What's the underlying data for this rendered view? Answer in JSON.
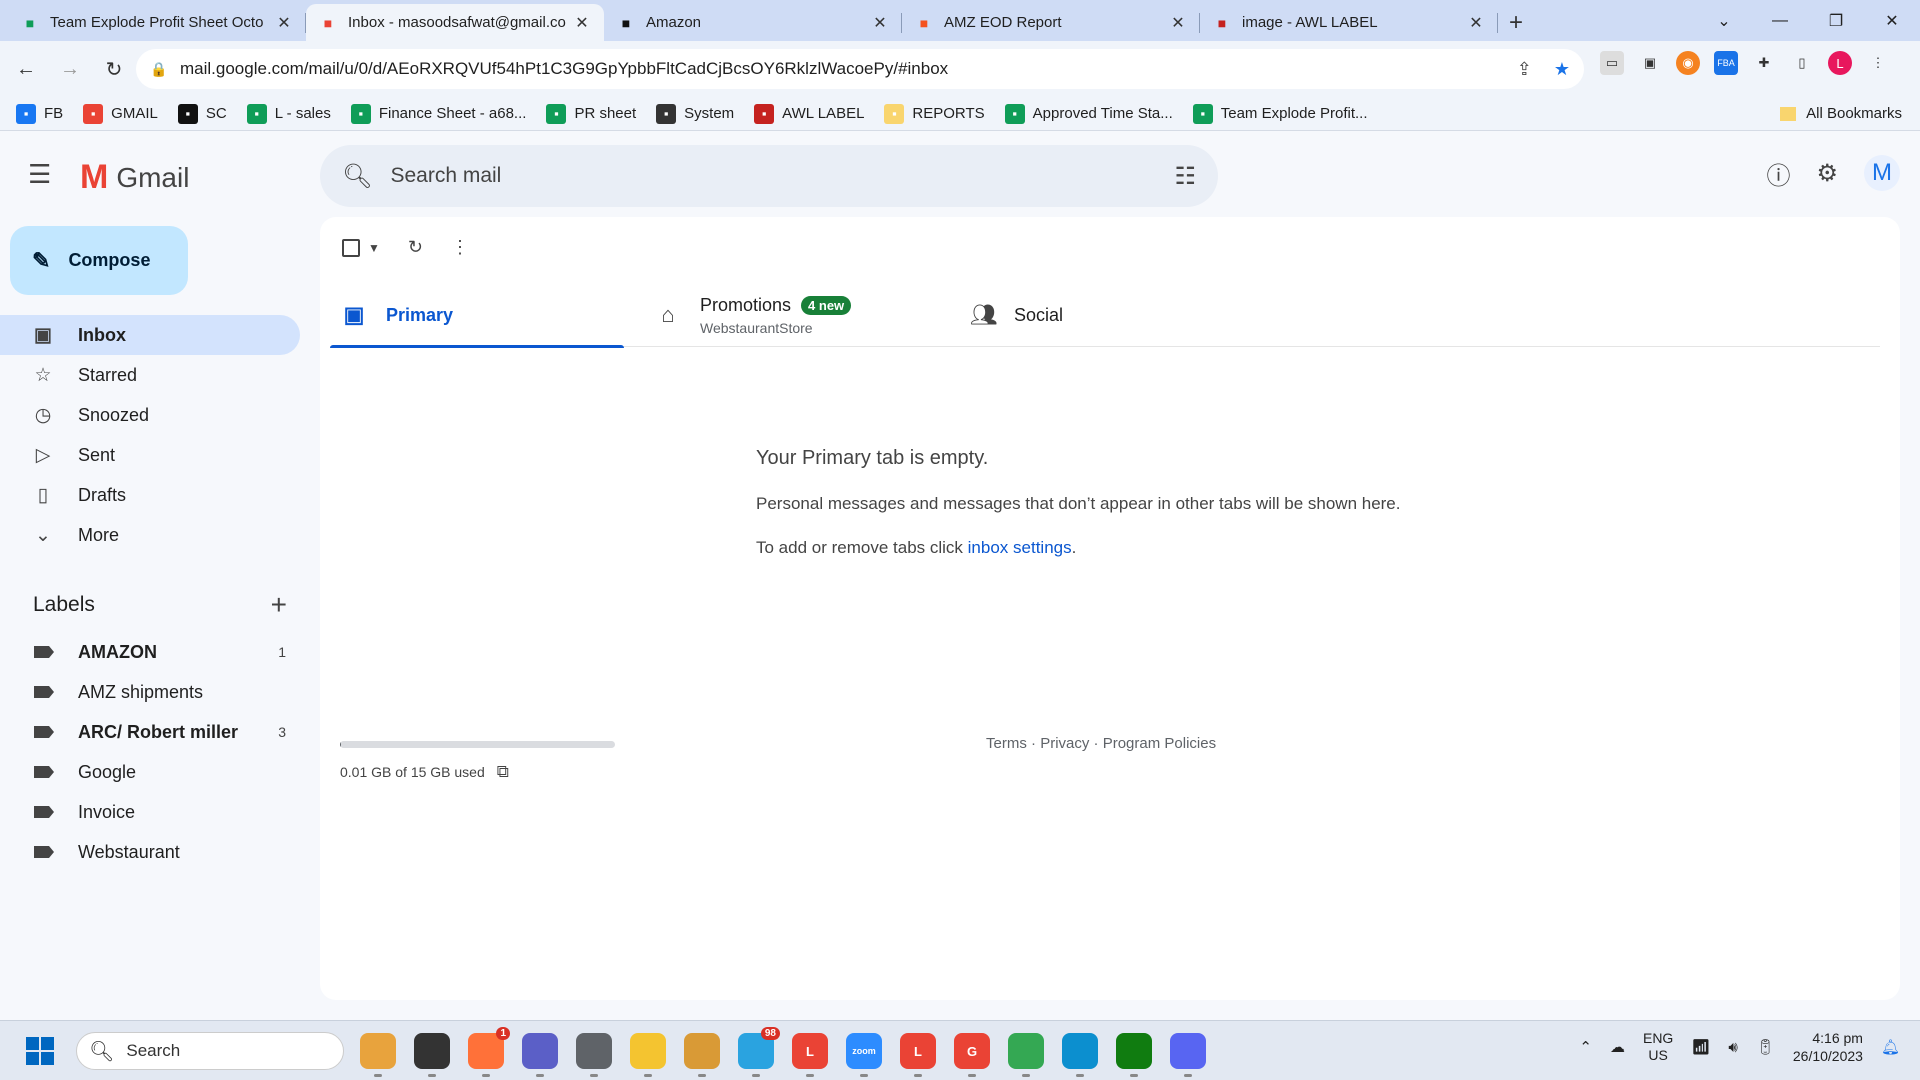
{
  "browser": {
    "tabs": [
      {
        "title": "Team Explode Profit Sheet Octo",
        "favicon": "sheets-icon",
        "color": "#0f9d58"
      },
      {
        "title": "Inbox - masoodsafwat@gmail.co",
        "favicon": "gmail-icon",
        "color": "#ea4335",
        "active": true
      },
      {
        "title": "Amazon",
        "favicon": "amazon-icon",
        "color": "#111111"
      },
      {
        "title": "AMZ EOD Report",
        "favicon": "report-icon",
        "color": "#f4511e"
      },
      {
        "title": "image - AWL LABEL",
        "favicon": "awl-icon",
        "color": "#c5221f"
      }
    ],
    "url": "mail.google.com/mail/u/0/d/AEoRXRQVUf54hPt1C3G9GpYpbbFltCadCjBcsOY6RklzlWacoePy/#inbox",
    "profile_initial": "L",
    "bookmarks": [
      {
        "label": "FB",
        "icon": "facebook-icon",
        "color": "#1877f2"
      },
      {
        "label": "GMAIL",
        "icon": "gmail-icon",
        "color": "#ea4335"
      },
      {
        "label": "SC",
        "icon": "amazon-icon",
        "color": "#111111"
      },
      {
        "label": "L - sales",
        "icon": "sheets-icon",
        "color": "#0f9d58"
      },
      {
        "label": "Finance Sheet - a68...",
        "icon": "sheets-icon",
        "color": "#0f9d58"
      },
      {
        "label": "PR sheet",
        "icon": "sheets-icon",
        "color": "#0f9d58"
      },
      {
        "label": "System",
        "icon": "globe-icon",
        "color": "#333333"
      },
      {
        "label": "AWL LABEL",
        "icon": "awl-icon",
        "color": "#c5221f"
      },
      {
        "label": "REPORTS",
        "icon": "folder-icon",
        "color": "#f9d56e"
      },
      {
        "label": "Approved Time Sta...",
        "icon": "sheets-icon",
        "color": "#0f9d58"
      },
      {
        "label": "Team Explode Profit...",
        "icon": "sheets-icon",
        "color": "#0f9d58"
      }
    ],
    "all_bookmarks": "All Bookmarks"
  },
  "gmail": {
    "brand": "Gmail",
    "search_placeholder": "Search mail",
    "avatar_initial": "M",
    "compose": "Compose",
    "nav": [
      {
        "label": "Inbox",
        "icon": "inbox-icon",
        "active": true
      },
      {
        "label": "Starred",
        "icon": "star-icon"
      },
      {
        "label": "Snoozed",
        "icon": "clock-icon"
      },
      {
        "label": "Sent",
        "icon": "send-icon"
      },
      {
        "label": "Drafts",
        "icon": "draft-icon"
      },
      {
        "label": "More",
        "icon": "chevron-down-icon"
      }
    ],
    "labels_title": "Labels",
    "labels": [
      {
        "name": "AMAZON",
        "count": "1",
        "bold": true
      },
      {
        "name": "AMZ shipments",
        "count": ""
      },
      {
        "name": "ARC/ Robert miller",
        "count": "3",
        "bold": true
      },
      {
        "name": "Google",
        "count": ""
      },
      {
        "name": "Invoice",
        "count": ""
      },
      {
        "name": "Webstaurant",
        "count": ""
      }
    ],
    "tabs": {
      "primary": "Primary",
      "promotions": "Promotions",
      "promotions_badge": "4 new",
      "promotions_sub": "WebstaurantStore",
      "social": "Social"
    },
    "empty": {
      "heading": "Your Primary tab is empty.",
      "line1": "Personal messages and messages that don’t appear in other tabs will be shown here.",
      "line2_prefix": "To add or remove tabs click ",
      "line2_link": "inbox settings",
      "line2_suffix": "."
    },
    "storage": {
      "text": "0.01 GB of 15 GB used",
      "fraction": 0.001
    },
    "footer": {
      "terms": "Terms",
      "privacy": "Privacy",
      "policies": "Program Policies",
      "sep": " · "
    }
  },
  "taskbar": {
    "search": "Search",
    "apps": [
      {
        "name": "widgets-icon",
        "color": "#e8a33d",
        "label": ""
      },
      {
        "name": "file-explorer-icon",
        "color": "#333333",
        "label": ""
      },
      {
        "name": "firefox-icon",
        "color": "#ff7139",
        "label": "",
        "badge": "1"
      },
      {
        "name": "teams-icon",
        "color": "#5b5fc7",
        "label": ""
      },
      {
        "name": "calculator-icon",
        "color": "#5f6368",
        "label": ""
      },
      {
        "name": "folder-icon",
        "color": "#f4c430",
        "label": ""
      },
      {
        "name": "app-icon",
        "color": "#d99a36",
        "label": ""
      },
      {
        "name": "telegram-icon",
        "color": "#2aa3e0",
        "label": "",
        "badge": "98"
      },
      {
        "name": "chrome-icon",
        "color": "#ea4335",
        "label": "L"
      },
      {
        "name": "zoom-icon",
        "color": "#2d8cff",
        "label": "zoom"
      },
      {
        "name": "chrome-icon",
        "color": "#ea4335",
        "label": "L"
      },
      {
        "name": "chrome-icon",
        "color": "#ea4335",
        "label": "G"
      },
      {
        "name": "chrome-icon",
        "color": "#34a853",
        "label": ""
      },
      {
        "name": "edge-icon",
        "color": "#0c8fcf",
        "label": ""
      },
      {
        "name": "xbox-icon",
        "color": "#107c10",
        "label": ""
      },
      {
        "name": "discord-icon",
        "color": "#5865f2",
        "label": ""
      }
    ],
    "lang_top": "ENG",
    "lang_bottom": "US",
    "time": "4:16 pm",
    "date": "26/10/2023"
  }
}
